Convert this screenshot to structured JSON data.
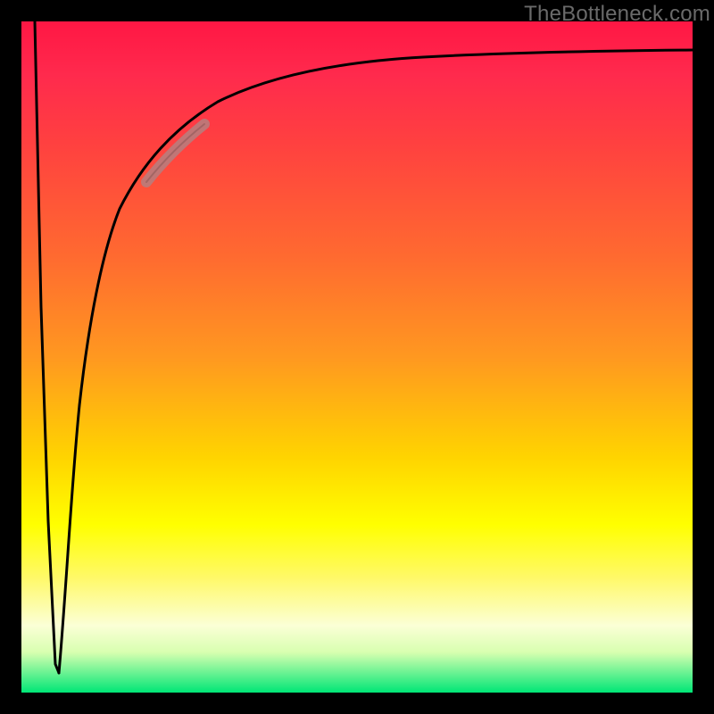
{
  "watermark": "TheBottleneck.com",
  "colors": {
    "frame": "#000000",
    "curve": "#000000",
    "highlight": "#b97c7c",
    "gradient_top": "#ff1744",
    "gradient_mid": "#ffff00",
    "gradient_bottom": "#00e676"
  },
  "chart_data": {
    "type": "line",
    "title": "",
    "xlabel": "",
    "ylabel": "",
    "xlim": [
      0,
      100
    ],
    "ylim": [
      0,
      100
    ],
    "grid": false,
    "legend": false,
    "annotations": [
      {
        "kind": "highlight_segment",
        "x_range": [
          17,
          25
        ],
        "note": "thick muted stroke on upper-left bend"
      }
    ],
    "series": [
      {
        "name": "left_dip",
        "x": [
          2,
          3,
          4,
          5
        ],
        "y": [
          100,
          55,
          15,
          3
        ]
      },
      {
        "name": "main_curve",
        "x": [
          5,
          7,
          9,
          11,
          13,
          15,
          18,
          22,
          26,
          30,
          35,
          40,
          50,
          60,
          70,
          80,
          90,
          100
        ],
        "y": [
          3,
          28,
          45,
          56,
          64,
          70,
          76,
          81,
          85,
          87,
          89,
          91,
          93,
          94,
          94.5,
          95,
          95.3,
          95.5
        ]
      }
    ]
  }
}
